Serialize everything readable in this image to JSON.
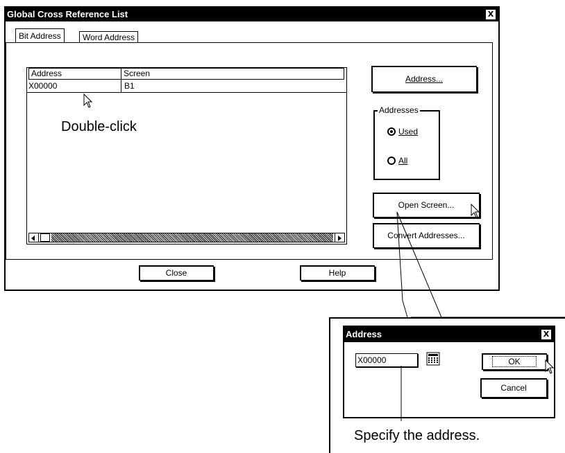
{
  "main_dialog": {
    "title": "Global Cross Reference List",
    "close_glyph": "X",
    "tabs": [
      "Bit Address",
      "Word Address"
    ],
    "columns": [
      "Address",
      "Screen"
    ],
    "rows": [
      [
        "X00000",
        "B1"
      ]
    ],
    "address_button": "Address...",
    "addresses_group": {
      "label": "Addresses",
      "options": [
        {
          "label": "Used",
          "selected": true
        },
        {
          "label": "All",
          "selected": false
        }
      ]
    },
    "open_screen_button": "Open Screen...",
    "convert_button": "Convert Addresses...",
    "close_button": "Close",
    "help_button": "Help"
  },
  "address_dialog": {
    "title": "Address",
    "close_glyph": "X",
    "address_value": "X00000",
    "ok_button": "OK",
    "cancel_button": "Cancel"
  },
  "annotations": {
    "double_click": "Double-click",
    "specify": "Specify the address."
  }
}
